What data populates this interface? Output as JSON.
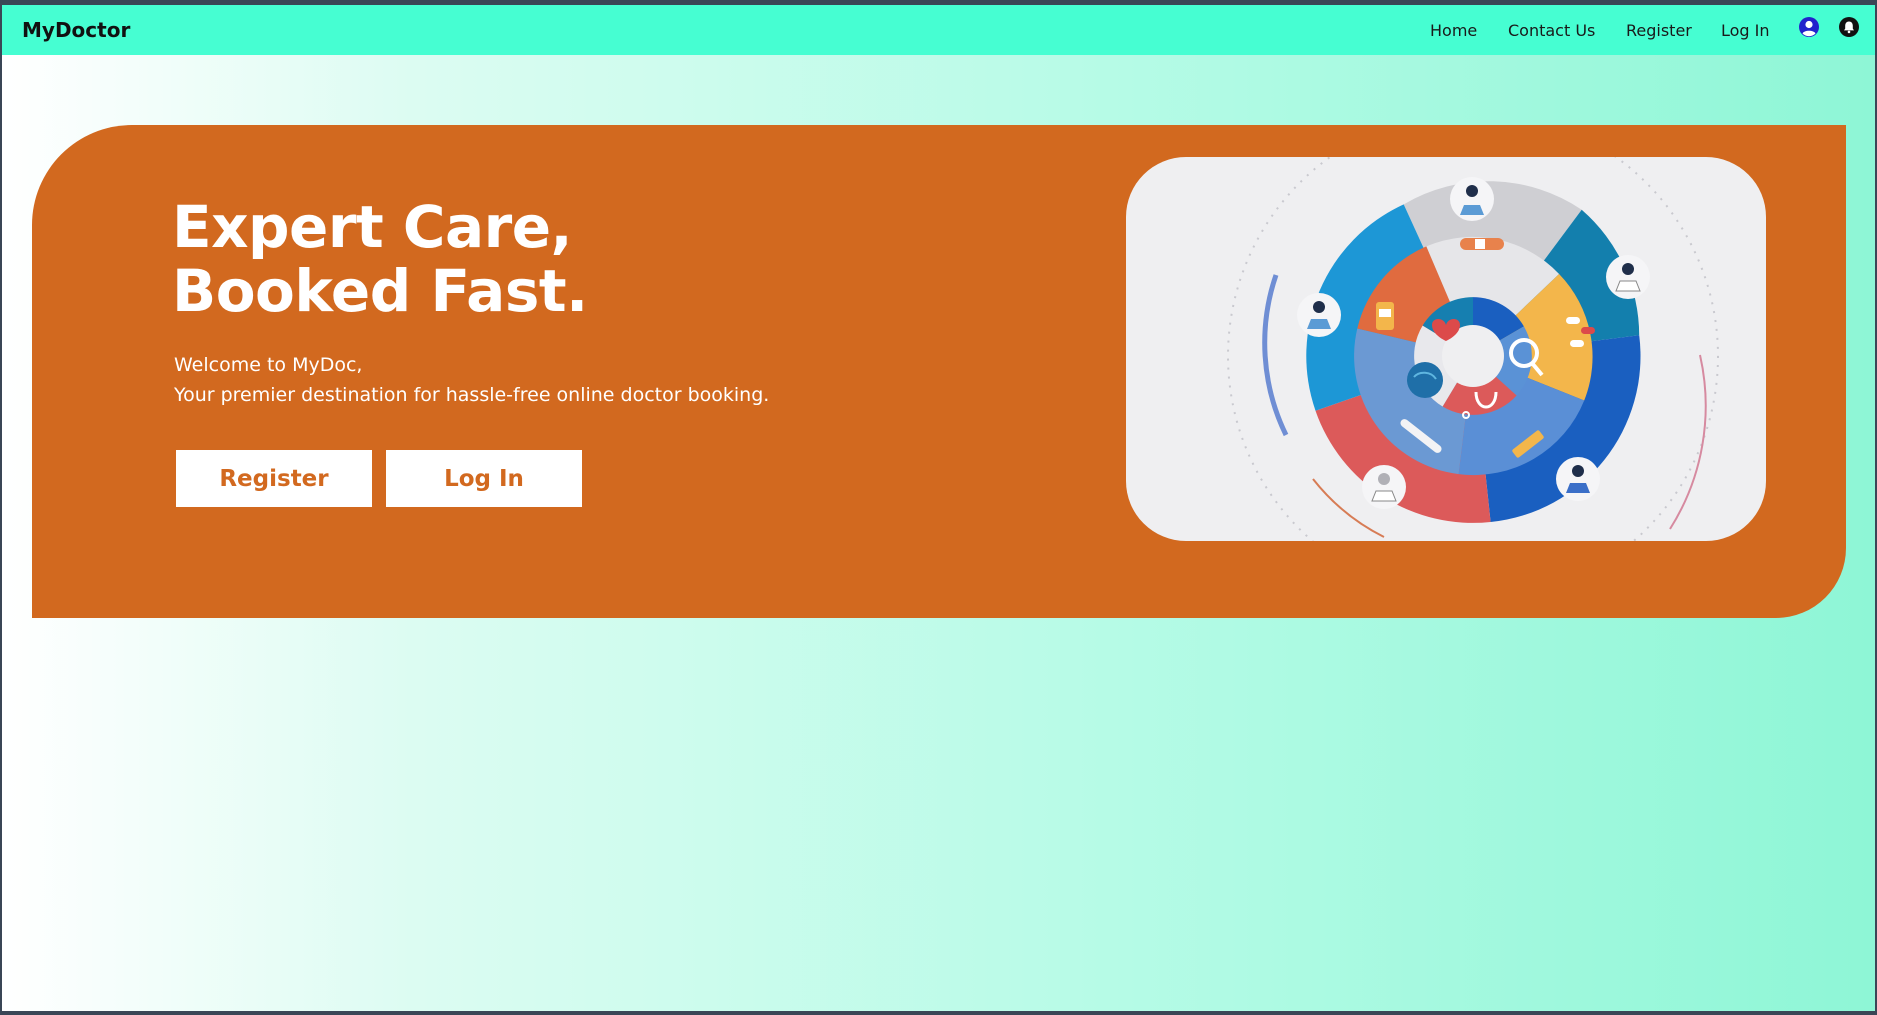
{
  "navbar": {
    "brand": "MyDoctor",
    "links": {
      "home": "Home",
      "contact": "Contact Us",
      "register": "Register",
      "login": "Log In"
    },
    "icons": [
      "user-circle-icon",
      "notification-bell-icon"
    ]
  },
  "hero": {
    "title_line1": "Expert Care,",
    "title_line2": "Booked Fast.",
    "welcome": "Welcome to MyDoc,",
    "tagline": "Your premier destination for hassle-free online doctor booking.",
    "register_button": "Register",
    "login_button": "Log In"
  },
  "colors": {
    "navbar": "#46fed2",
    "hero": "#d2691f",
    "button_text": "#d2691f",
    "icon_user": "#2222cc"
  }
}
